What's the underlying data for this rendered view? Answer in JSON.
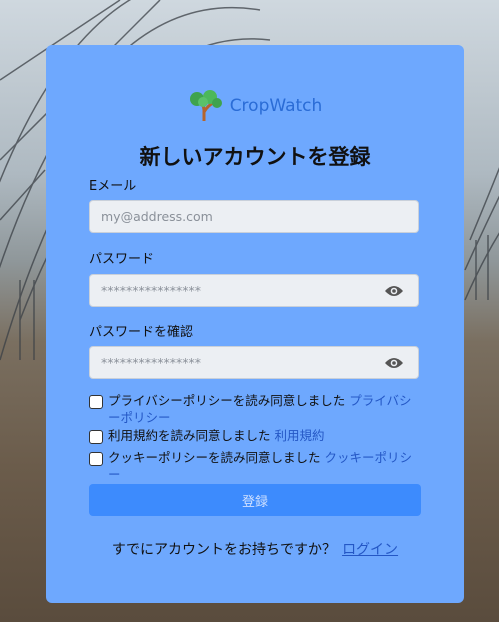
{
  "brand": {
    "name": "CropWatch",
    "icon": "tree-logo-icon"
  },
  "form": {
    "title": "新しいアカウントを登録",
    "email": {
      "label": "Eメール",
      "placeholder": "my@address.com"
    },
    "password": {
      "label": "パスワード",
      "placeholder": "****************",
      "toggle_icon": "eye-icon"
    },
    "confirm": {
      "label": "パスワードを確認",
      "placeholder": "****************",
      "toggle_icon": "eye-icon"
    },
    "agreements": [
      {
        "text": "プライバシーポリシーを読み同意しました",
        "link": "プライバシーポリシー",
        "checked": false
      },
      {
        "text": "利用規約を読み同意しました",
        "link": "利用規約",
        "checked": false
      },
      {
        "text": "クッキーポリシーを読み同意しました",
        "link": "クッキーポリシー",
        "checked": false
      }
    ],
    "submit_label": "登録"
  },
  "footer": {
    "text": "すでにアカウントをお持ちですか？",
    "login_link": "ログイン"
  },
  "colors": {
    "card": "#6ea8fe",
    "button": "#3d8bfd",
    "link": "#2457c5"
  }
}
